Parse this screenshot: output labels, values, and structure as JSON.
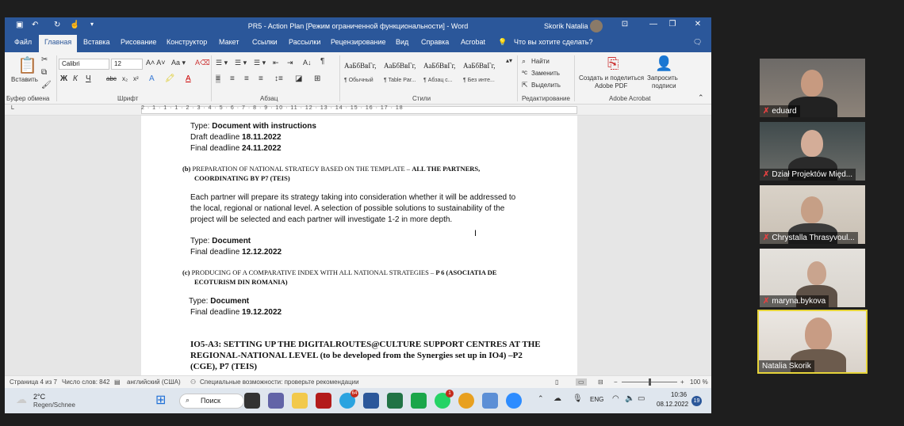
{
  "titlebar": {
    "doc_title": "PR5 - Action Plan [Режим ограниченной функциональности] - Word",
    "user_name": "Skorik Natalia"
  },
  "tabs": [
    "Файл",
    "Главная",
    "Вставка",
    "Рисование",
    "Конструктор",
    "Макет",
    "Ссылки",
    "Рассылки",
    "Рецензирование",
    "Вид",
    "Справка",
    "Acrobat"
  ],
  "active_tab": "Главная",
  "tell_me": "Что вы хотите сделать?",
  "ribbon": {
    "paste_label": "Вставить",
    "clipboard_label": "Буфер обмена",
    "font_label": "Шрифт",
    "font_name": "Calibri",
    "font_size": "12",
    "paragraph_label": "Абзац",
    "styles_label": "Стили",
    "styles": [
      {
        "sample": "АаБбВвГг,",
        "name": "¶ Обычный"
      },
      {
        "sample": "АаБбВвГг,",
        "name": "¶ Table Par..."
      },
      {
        "sample": "АаБбВвГг,",
        "name": "¶ Абзац с..."
      },
      {
        "sample": "АаБбВвГг,",
        "name": "¶ Без инте..."
      }
    ],
    "find": "Найти",
    "replace": "Заменить",
    "select": "Выделить",
    "editing_label": "Редактирование",
    "create_pdf_1": "Создать и поделиться",
    "create_pdf_2": "Adobe PDF",
    "request_sign_1": "Запросить",
    "request_sign_2": "подписи",
    "acrobat_label": "Adobe Acrobat"
  },
  "ruler": "2 · 1 · 1 · 1 · 2 · 3 · 4 · 5 · 6 · 7 · 8 · 9 · 10 · 11 · 12 · 13 · 14 · 15 · 16 · 17 · 18",
  "document": {
    "type1_label": "Type: ",
    "type1_value": "Document with instructions",
    "draft1_label": "Draft deadline ",
    "draft1_value": "18.11.2022",
    "final1_label": "Final deadline ",
    "final1_value": "24.11.2022",
    "b_marker": "(b)",
    "b_title": "PREPARATION OF NATIONAL STRATEGY BASED ON THE TEMPLATE – ",
    "b_partners": "ALL THE PARTNERS,",
    "b_partners2": "COORDINATING BY P7 (TEIS)",
    "para1": "Each partner will prepare its strategy taking into consideration whether it will be addressed to",
    "para2": "the local, regional or national level. A selection of possible solutions to sustainability of the",
    "para3": "project will be selected and each partner will investigate 1-2 in more depth.",
    "type2_label": "Type: ",
    "type2_value": "Document",
    "final2_label": "Final deadline ",
    "final2_value": "12.12.2022",
    "c_marker": "(c)",
    "c_title": "PRODUCING OF A COMPARATIVE INDEX WITH ALL NATIONAL STRATEGIES – ",
    "c_partner": "P 6 (ASOCIATIA DE",
    "c_partner2": "ECOTURISM DIN ROMANIA)",
    "type3_label": "Type: ",
    "type3_value": "Document",
    "final3_label": "Final deadline ",
    "final3_value": "19.12.2022",
    "io5_1": "IO5-A3: SETTING UP THE DIGITALROUTES@CULTURE SUPPORT CENTRES AT THE",
    "io5_2": "REGIONAL-NATIONAL LEVEL (to be developed from the Synergies set up in IO4) –P2",
    "io5_3": "(CGE), P7 (TEIS)"
  },
  "status": {
    "page": "Страница 4 из 7",
    "words": "Число слов: 842",
    "language": "английский (США)",
    "accessibility": "Специальные возможности: проверьте рекомендации",
    "zoom": "100 %"
  },
  "taskbar": {
    "temp": "2°C",
    "weather": "Regen/Schnee",
    "search": "Поиск",
    "lang": "ENG",
    "time": "10:36",
    "date": "08.12.2022",
    "notif_count": "19",
    "badge_telegram": "64",
    "badge_whatsapp": "1"
  },
  "participants": [
    {
      "name": "eduard"
    },
    {
      "name": "Dział Projektów Międ..."
    },
    {
      "name": "Chrystalla Thrasyvoul..."
    },
    {
      "name": "maryna.bykova"
    },
    {
      "name": "Natalia Skorik"
    }
  ],
  "colors": {
    "word_blue": "#2b579a",
    "active_speaker": "#e6d43a",
    "mic_muted": "#e24141"
  }
}
